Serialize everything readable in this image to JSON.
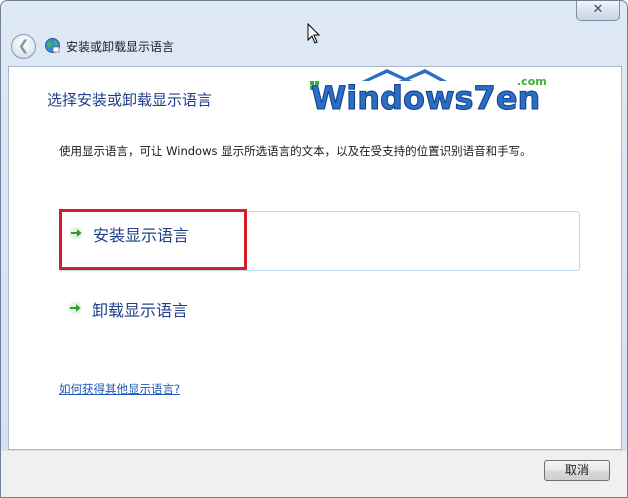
{
  "window": {
    "breadcrumb_title": "安装或卸载显示语言",
    "close_glyph": "✕",
    "back_glyph": "❮"
  },
  "logo": {
    "main": "Windows7en",
    "sup": ".com",
    "colors": {
      "blue": "#2a6fc4",
      "green": "#3cae3a"
    }
  },
  "page": {
    "title": "选择安装或卸载显示语言",
    "description": "使用显示语言，可让 Windows 显示所选语言的文本，以及在受支持的位置识别语音和手写。",
    "options": [
      {
        "label": "安装显示语言",
        "icon": "green-arrow-icon"
      },
      {
        "label": "卸载显示语言",
        "icon": "green-arrow-icon"
      }
    ],
    "help_link": "如何获得其他显示语言?"
  },
  "footer": {
    "cancel_label": "取消"
  },
  "colors": {
    "highlight_red": "#d41f26",
    "link_blue": "#1c56b8",
    "title_blue": "#1e3f8a"
  }
}
